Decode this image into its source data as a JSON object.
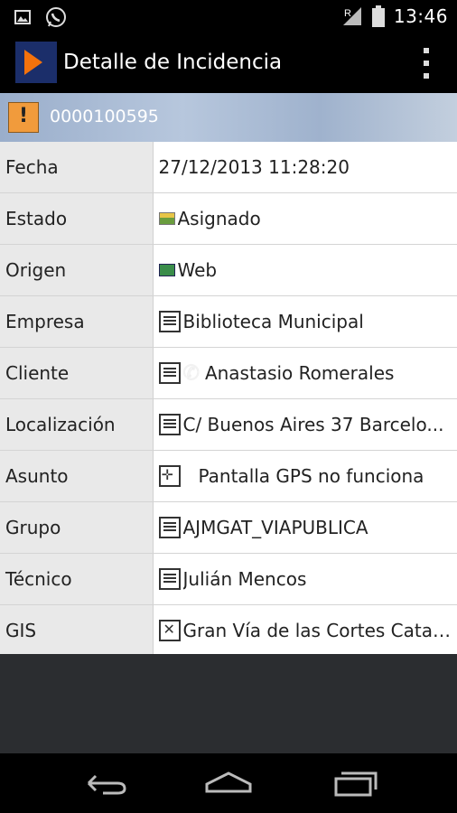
{
  "status_bar": {
    "time": "13:46",
    "icons": [
      "image-icon",
      "whatsapp-icon",
      "signal-icon",
      "battery-icon"
    ]
  },
  "action_bar": {
    "title": "Detalle de Incidencia",
    "logo": "app-logo-icon",
    "overflow_icon": "overflow-menu-icon"
  },
  "incident": {
    "id": "0000100595",
    "icon": "alert-icon",
    "accent_color": "#f19b3c"
  },
  "details": [
    {
      "label": "Fecha",
      "value": "27/12/2013 11:28:20",
      "icon": ""
    },
    {
      "label": "Estado",
      "value": "Asignado",
      "icon": "status-flag-icon"
    },
    {
      "label": "Origen",
      "value": "Web",
      "icon": "computer-icon"
    },
    {
      "label": "Empresa",
      "value": "Biblioteca Municipal",
      "icon": "document-icon"
    },
    {
      "label": "Cliente",
      "value": "Anastasio Romerales",
      "icon": "document-icon"
    },
    {
      "label": "Localización",
      "value": "C/ Buenos Aires 37 Barcelo...",
      "icon": "document-icon"
    },
    {
      "label": "Asunto",
      "value": "Pantalla GPS no funciona",
      "icon": "move-icon"
    },
    {
      "label": "Grupo",
      "value": "AJMGAT_VIAPUBLICA",
      "icon": "document-icon"
    },
    {
      "label": "Técnico",
      "value": "Julián Mencos",
      "icon": "document-icon"
    },
    {
      "label": "GIS",
      "value": "Gran Vía de las Cortes Catal...",
      "icon": "expand-icon"
    }
  ],
  "nav_bar": {
    "icons": [
      "back-icon",
      "home-icon",
      "recents-icon"
    ]
  }
}
